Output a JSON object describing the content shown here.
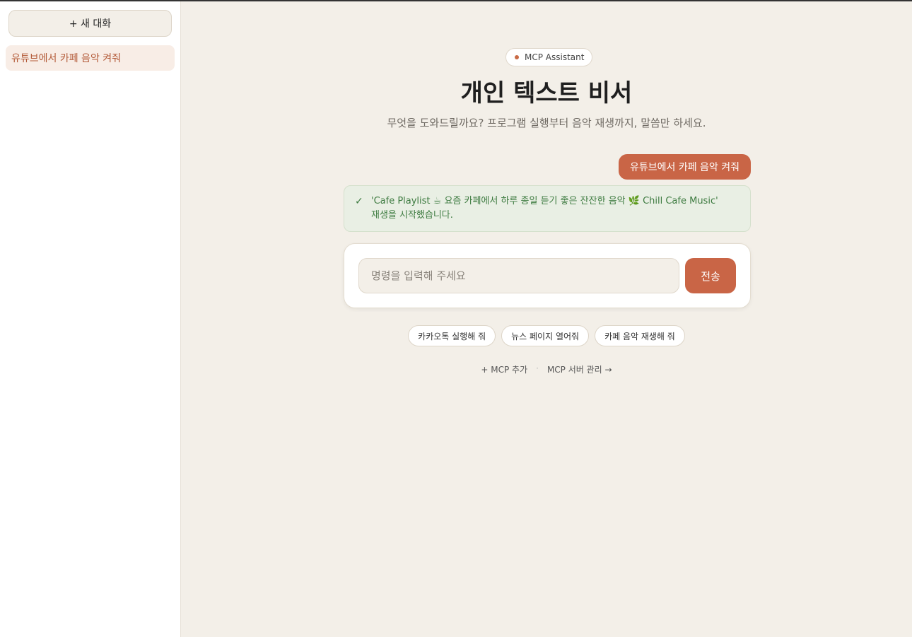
{
  "sidebar": {
    "new_chat_label": "+ 새 대화",
    "conversations": [
      {
        "label": "유튜브에서 카페 음악 켜줘"
      }
    ]
  },
  "header": {
    "badge_label": "MCP Assistant",
    "title": "개인 텍스트 비서",
    "subtitle": "무엇을 도와드릴까요? 프로그램 실행부터 음악 재생까지, 말씀만 하세요."
  },
  "chat": {
    "user_message": "유튜브에서 카페 음악 켜줘",
    "result_check": "✓",
    "result_text": "'Cafe Playlist ☕ 요즘 카페에서 하루 종일 듣기 좋은 잔잔한 음악 🌿 Chill Cafe Music' 재생을 시작했습니다."
  },
  "input": {
    "placeholder": "명령을 입력해 주세요",
    "value": "",
    "send_label": "전송"
  },
  "suggestions": [
    "카카오톡 실행해 줘",
    "뉴스 페이지 열어줘",
    "카페 음악 재생해 줘"
  ],
  "links": {
    "add_mcp": "+ MCP 추가",
    "separator": "·",
    "manage_mcp": "MCP 서버 관리 →"
  },
  "colors": {
    "accent": "#c96546",
    "background": "#f3efe8",
    "success_text": "#3c7a3f",
    "success_bg": "#e9efe4"
  }
}
